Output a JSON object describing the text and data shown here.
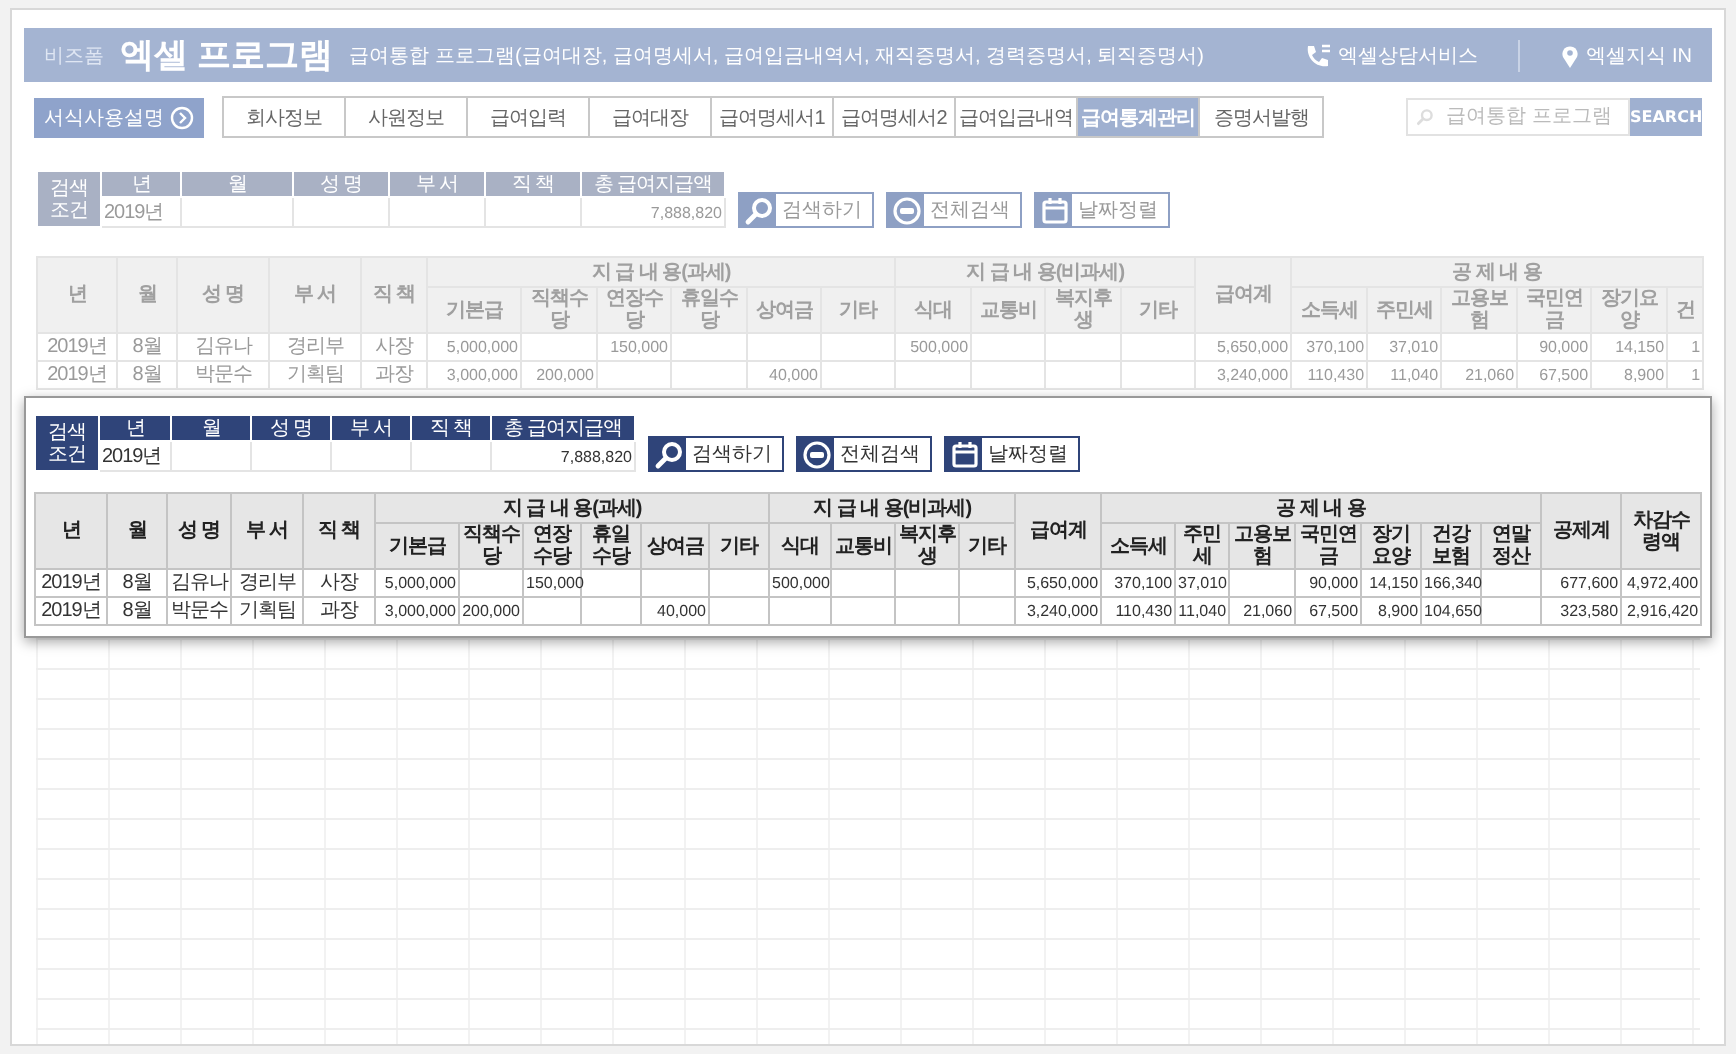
{
  "header": {
    "brand_small": "비즈폼",
    "brand": "엑셀 프로그램",
    "subtitle": "급여통합 프로그램(급여대장, 급여명세서, 급여입금내역서, 재직증명서, 경력증명서, 퇴직증명서)",
    "links": [
      {
        "kind": "phone",
        "text": "엑셀상담서비스"
      },
      {
        "kind": "pin",
        "text": "엑셀지식 IN"
      }
    ]
  },
  "nav": {
    "guide_button": "서식사용설명",
    "tabs": [
      {
        "label": "회사정보",
        "selected": false
      },
      {
        "label": "사원정보",
        "selected": false
      },
      {
        "label": "급여입력",
        "selected": false
      },
      {
        "label": "급여대장",
        "selected": false
      },
      {
        "label": "급여명세서1",
        "selected": false
      },
      {
        "label": "급여명세서2",
        "selected": false
      },
      {
        "label": "급여입금내역",
        "selected": false
      },
      {
        "label": "급여통계관리",
        "selected": true
      },
      {
        "label": "증명서발행",
        "selected": false
      }
    ],
    "search": {
      "placeholder": "급여통합 프로그램",
      "button": "SEARCH"
    }
  },
  "views": [
    {
      "kind": "background",
      "filter": {
        "label": "검색 조건",
        "columns": [
          {
            "label": "년",
            "value": "2019년"
          },
          {
            "label": "월"
          },
          {
            "label": "성 명"
          },
          {
            "label": "부 서"
          },
          {
            "label": "직 책"
          },
          {
            "label": "총 급여지급액",
            "value": "7,888,820"
          }
        ]
      },
      "buttons": [
        {
          "kind": "search",
          "label": "검색하기"
        },
        {
          "kind": "all",
          "label": "전체검색"
        },
        {
          "kind": "calendar",
          "label": "날짜정렬"
        }
      ],
      "table": {
        "header": [
          {
            "kind": "single",
            "label": "년"
          },
          {
            "kind": "single",
            "label": "월"
          },
          {
            "kind": "single",
            "label": "성 명"
          },
          {
            "kind": "single",
            "label": "부 서"
          },
          {
            "kind": "single",
            "label": "직 책"
          },
          {
            "kind": "group",
            "label": "지 급 내 용(과세)",
            "columns": [
              "기본급",
              "직책수당",
              "연장수당",
              "휴일수당",
              "상여금",
              "기타"
            ]
          },
          {
            "kind": "group",
            "label": "지 급 내 용(비과세)",
            "columns": [
              "식대",
              "교통비",
              "복지후생",
              "기타"
            ]
          },
          {
            "kind": "single",
            "label": "급여계"
          },
          {
            "kind": "group",
            "label": "공 제 내 용",
            "columns": [
              "소득세",
              "주민세",
              "고용보험",
              "국민연금",
              "장기요양",
              "건"
            ]
          }
        ],
        "rows": [
          [
            "2019년",
            "8월",
            "김유나",
            "경리부",
            "사장",
            "5,000,000",
            null,
            "150,000",
            null,
            null,
            null,
            "500,000",
            null,
            null,
            null,
            "5,650,000",
            "370,100",
            "37,010",
            null,
            "90,000",
            "14,150",
            "1"
          ],
          [
            "2019년",
            "8월",
            "박문수",
            "기획팀",
            "과장",
            "3,000,000",
            "200,000",
            null,
            null,
            "40,000",
            null,
            null,
            null,
            null,
            null,
            "3,240,000",
            "110,430",
            "11,040",
            "21,060",
            "67,500",
            "8,900",
            "1"
          ]
        ]
      }
    },
    {
      "kind": "inset",
      "filter": {
        "label": "검색 조건",
        "columns": [
          {
            "label": "년",
            "value": "2019년"
          },
          {
            "label": "월"
          },
          {
            "label": "성 명"
          },
          {
            "label": "부 서"
          },
          {
            "label": "직 책"
          },
          {
            "label": "총 급여지급액",
            "value": "7,888,820"
          }
        ]
      },
      "buttons": [
        {
          "kind": "search",
          "label": "검색하기"
        },
        {
          "kind": "all",
          "label": "전체검색"
        },
        {
          "kind": "calendar",
          "label": "날짜정렬"
        }
      ],
      "table": {
        "header": [
          {
            "kind": "single",
            "label": "년"
          },
          {
            "kind": "single",
            "label": "월"
          },
          {
            "kind": "single",
            "label": "성 명"
          },
          {
            "kind": "single",
            "label": "부 서"
          },
          {
            "kind": "single",
            "label": "직 책"
          },
          {
            "kind": "group",
            "label": "지 급 내 용(과세)",
            "columns": [
              "기본급",
              "직책수당",
              "연장수당",
              "휴일수당",
              "상여금",
              "기타"
            ]
          },
          {
            "kind": "group",
            "label": "지 급 내 용(비과세)",
            "columns": [
              "식대",
              "교통비",
              "복지후생",
              "기타"
            ]
          },
          {
            "kind": "single",
            "label": "급여계"
          },
          {
            "kind": "group",
            "label": "공 제 내 용",
            "columns": [
              "소득세",
              "주민세",
              "고용보험",
              "국민연금",
              "장기요양",
              "건강보험",
              "연말정산"
            ]
          },
          {
            "kind": "single",
            "label": "공제계"
          },
          {
            "kind": "single",
            "label": "차감수령액"
          }
        ],
        "rows": [
          [
            "2019년",
            "8월",
            "김유나",
            "경리부",
            "사장",
            "5,000,000",
            null,
            "150,000",
            null,
            null,
            null,
            "500,000",
            null,
            null,
            null,
            "5,650,000",
            "370,100",
            "37,010",
            null,
            "90,000",
            "14,150",
            "166,340",
            null,
            "677,600",
            "4,972,400"
          ],
          [
            "2019년",
            "8월",
            "박문수",
            "기획팀",
            "과장",
            "3,000,000",
            "200,000",
            null,
            null,
            "40,000",
            null,
            null,
            null,
            null,
            null,
            "3,240,000",
            "110,430",
            "11,040",
            "21,060",
            "67,500",
            "8,900",
            "104,650",
            null,
            "323,580",
            "2,916,420"
          ]
        ]
      }
    }
  ]
}
